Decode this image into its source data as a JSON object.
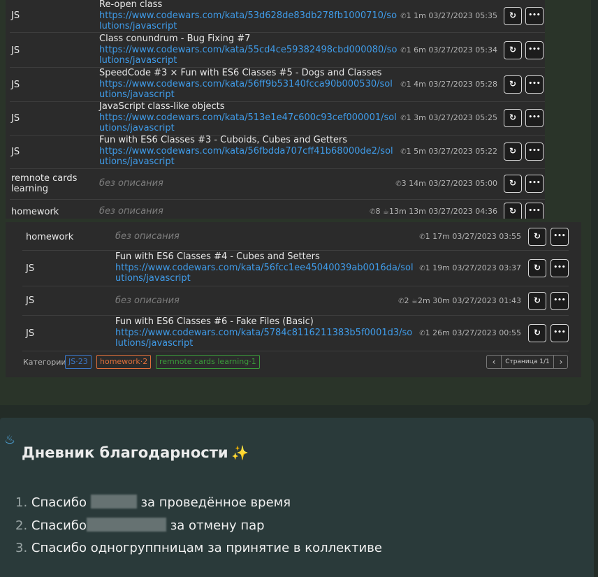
{
  "table1": {
    "rows": [
      {
        "category": "JS",
        "title": "Re-open class",
        "link": "https://www.codewars.com/kata/53d628de83db278fb1000710/solutions/javascript",
        "calls": "1",
        "duration": "1m",
        "timestamp": "03/27/2023 05:35"
      },
      {
        "category": "JS",
        "title": "Class conundrum - Bug Fixing #7",
        "link": "https://www.codewars.com/kata/55cd4ce59382498cbd000080/solutions/javascript",
        "calls": "1",
        "duration": "6m",
        "timestamp": "03/27/2023 05:34"
      },
      {
        "category": "JS",
        "title": "SpeedCode #3 × Fun with ES6 Classes #5 - Dogs and Classes",
        "link": "https://www.codewars.com/kata/56ff9b53140fcca90b000530/solutions/javascript",
        "calls": "1",
        "duration": "4m",
        "timestamp": "03/27/2023 05:28"
      },
      {
        "category": "JS",
        "title": "JavaScript class-like objects",
        "link": "https://www.codewars.com/kata/513e1e47c600c93cef000001/solutions/javascript",
        "calls": "1",
        "duration": "3m",
        "timestamp": "03/27/2023 05:25"
      },
      {
        "category": "JS",
        "title": "Fun with ES6 Classes #3 - Cuboids, Cubes and Getters",
        "link": "https://www.codewars.com/kata/56fbdda707cff41b68000de2/solutions/javascript",
        "calls": "1",
        "duration": "5m",
        "timestamp": "03/27/2023 05:22"
      },
      {
        "category": "remnote cards learning",
        "description": "без описания",
        "calls": "3",
        "duration": "14m",
        "timestamp": "03/27/2023 05:00"
      },
      {
        "category": "homework",
        "description": "без описания",
        "calls": "8",
        "breaks": "13m",
        "duration": "13m",
        "timestamp": "03/27/2023 04:36"
      }
    ]
  },
  "table2": {
    "rows": [
      {
        "category": "homework",
        "description": "без описания",
        "calls": "1",
        "duration": "17m",
        "timestamp": "03/27/2023 03:55"
      },
      {
        "category": "JS",
        "title": "Fun with ES6 Classes #4 - Cubes and Setters",
        "link": "https://www.codewars.com/kata/56fcc1ee45040039ab0016da/solutions/javascript",
        "calls": "1",
        "duration": "19m",
        "timestamp": "03/27/2023 03:37"
      },
      {
        "category": "JS",
        "description": "без описания",
        "calls": "2",
        "breaks": "2m",
        "duration": "30m",
        "timestamp": "03/27/2023 01:43"
      },
      {
        "category": "JS",
        "title": "Fun with ES6 Classes #6 - Fake Files (Basic)",
        "link": "https://www.codewars.com/kata/5784c8116211383b5f0001d3/solutions/javascript",
        "calls": "1",
        "duration": "26m",
        "timestamp": "03/27/2023 00:55"
      }
    ],
    "categories_label": "Категории",
    "tags": [
      {
        "text": "JS·23",
        "color": "#3a78c8"
      },
      {
        "text": "homework·2",
        "color": "#e0703a"
      },
      {
        "text": "remnote cards learning·1",
        "color": "#3a9a3a"
      }
    ],
    "pager": "Страница 1/1"
  },
  "icons": {
    "calls": "phone-icon",
    "breaks": "coffee-icon",
    "refresh": "refresh-icon",
    "more": "more-icon"
  },
  "gratitude": {
    "title": "Дневник благодарности",
    "items": [
      {
        "num": "1.",
        "before": "Спасибо",
        "after": "за проведённое время"
      },
      {
        "num": "2.",
        "before": "Спасибо",
        "after": "за отмену пар"
      },
      {
        "num": "3.",
        "before": "Спасибо одногруппницам за принятие в коллективе",
        "after": ""
      }
    ]
  }
}
